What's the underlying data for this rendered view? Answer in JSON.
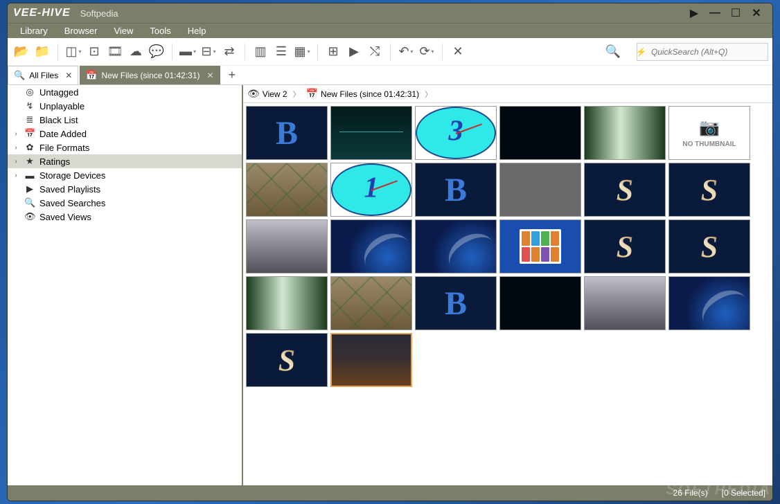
{
  "app": {
    "name": "VEE-HIVE",
    "subtitle": "Softpedia"
  },
  "menu": {
    "library": "Library",
    "browser": "Browser",
    "view": "View",
    "tools": "Tools",
    "help": "Help"
  },
  "search": {
    "placeholder": "QuickSearch (Alt+Q)"
  },
  "tabs": {
    "all_files": "All Files",
    "new_files": "New Files (since 01:42:31)"
  },
  "sidebar": {
    "items": [
      {
        "icon": "◎",
        "label": "Untagged",
        "expandable": false
      },
      {
        "icon": "↯",
        "label": "Unplayable",
        "expandable": false
      },
      {
        "icon": "≣",
        "label": "Black List",
        "expandable": false
      },
      {
        "icon": "📅",
        "label": "Date Added",
        "expandable": true
      },
      {
        "icon": "✿",
        "label": "File Formats",
        "expandable": true
      },
      {
        "icon": "★",
        "label": "Ratings",
        "expandable": true,
        "selected": true
      },
      {
        "icon": "▬",
        "label": "Storage Devices",
        "expandable": true
      },
      {
        "icon": "▶",
        "label": "Saved Playlists",
        "expandable": false
      },
      {
        "icon": "🔍",
        "label": "Saved Searches",
        "expandable": false
      },
      {
        "icon": "👁",
        "label": "Saved Views",
        "expandable": false
      }
    ]
  },
  "breadcrumb": {
    "view": "View 2",
    "location": "New Files (since 01:42:31)"
  },
  "thumbnails": [
    {
      "type": "b"
    },
    {
      "type": "teal"
    },
    {
      "type": "clock",
      "num": "3"
    },
    {
      "type": "dark"
    },
    {
      "type": "green"
    },
    {
      "type": "nothumb",
      "label": "NO THUMBNAIL"
    },
    {
      "type": "ground"
    },
    {
      "type": "clock",
      "num": "1"
    },
    {
      "type": "b"
    },
    {
      "type": "grey"
    },
    {
      "type": "s"
    },
    {
      "type": "s"
    },
    {
      "type": "street"
    },
    {
      "type": "blueswirl"
    },
    {
      "type": "blueswirl"
    },
    {
      "type": "apps"
    },
    {
      "type": "s"
    },
    {
      "type": "s"
    },
    {
      "type": "green"
    },
    {
      "type": "ground"
    },
    {
      "type": "b"
    },
    {
      "type": "dark"
    },
    {
      "type": "street"
    },
    {
      "type": "blueswirl"
    },
    {
      "type": "s"
    },
    {
      "type": "sunset",
      "selected": true
    }
  ],
  "status": {
    "count": "26 File(s)",
    "selected": "[0 Selected]"
  },
  "watermark": "SOFTPEDIA"
}
